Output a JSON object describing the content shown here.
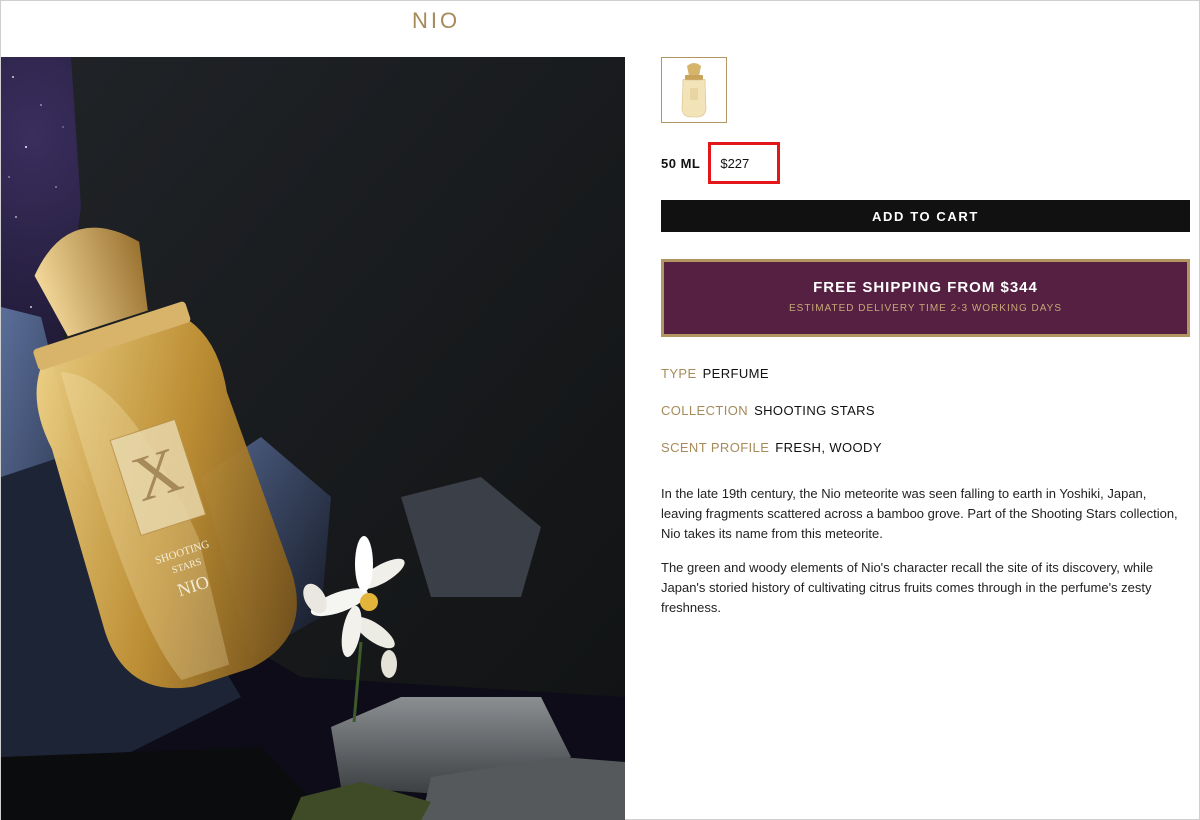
{
  "product": {
    "title": "NIO",
    "size_label": "50 ML",
    "price": "$227"
  },
  "cart": {
    "button_label": "ADD TO CART"
  },
  "shipping": {
    "title": "FREE SHIPPING FROM $344",
    "subtitle": "ESTIMATED DELIVERY TIME 2-3 WORKING DAYS"
  },
  "attributes": [
    {
      "key": "TYPE",
      "value": "PERFUME"
    },
    {
      "key": "COLLECTION",
      "value": "SHOOTING STARS"
    },
    {
      "key": "SCENT PROFILE",
      "value": "FRESH, WOODY"
    }
  ],
  "description": [
    "In the late 19th century, the Nio meteorite was seen falling to earth in Yoshiki, Japan, leaving fragments scattered across a bamboo grove. Part of the Shooting Stars collection, Nio takes its name from this meteorite.",
    "The green and woody elements of Nio's character recall the site of its discovery, while Japan's storied history of cultivating citrus fruits comes through in the perfume's zesty freshness."
  ],
  "bottle_label": {
    "mark": "X",
    "line1": "SHOOTING",
    "line2": "STARS",
    "line3": "NIO"
  },
  "colors": {
    "gold": "#a68a5a",
    "plum": "#552041",
    "highlight": "#e3161a"
  }
}
